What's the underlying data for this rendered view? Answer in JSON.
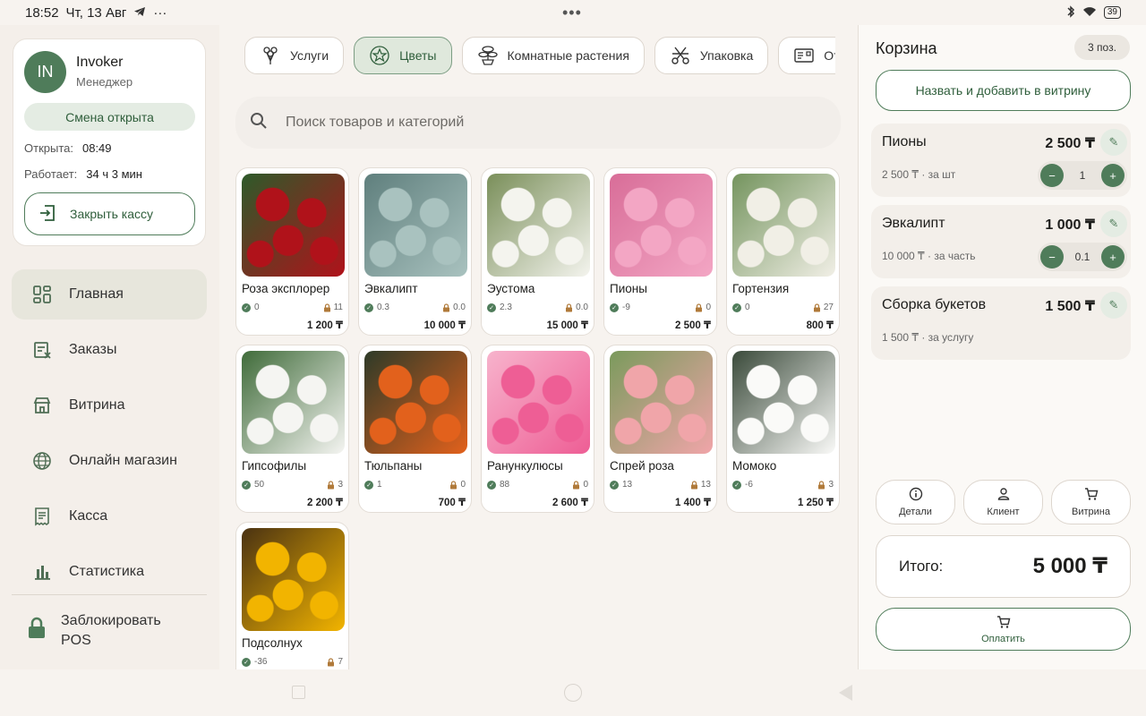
{
  "status_bar": {
    "time": "18:52",
    "date": "Чт, 13 Авг",
    "dots": "•••",
    "battery": "39"
  },
  "user": {
    "initials": "IN",
    "name": "Invoker",
    "role": "Менеджер",
    "shift_status": "Смена открыта",
    "opened_label": "Открыта:",
    "opened_time": "08:49",
    "working_label": "Работает:",
    "working_time": "34 ч 3 мин",
    "close_register": "Закрыть кассу"
  },
  "nav": {
    "items": [
      {
        "label": "Главная",
        "icon": "grid-icon",
        "active": true
      },
      {
        "label": "Заказы",
        "icon": "orders-icon"
      },
      {
        "label": "Витрина",
        "icon": "storefront-icon"
      },
      {
        "label": "Онлайн магазин",
        "icon": "globe-icon"
      },
      {
        "label": "Касса",
        "icon": "receipt-icon"
      },
      {
        "label": "Статистика",
        "icon": "bar-chart-icon"
      }
    ],
    "lock_label_1": "Заблокировать",
    "lock_label_2": "POS"
  },
  "tabs": [
    {
      "label": "Услуги",
      "icon": "bouquet-icon"
    },
    {
      "label": "Цветы",
      "icon": "flower-icon",
      "active": true
    },
    {
      "label": "Комнатные растения",
      "icon": "bonsai-icon"
    },
    {
      "label": "Упаковка",
      "icon": "scissors-icon"
    },
    {
      "label": "Открытки",
      "icon": "postcard-icon"
    }
  ],
  "search": {
    "placeholder": "Поиск товаров и категорий"
  },
  "products": [
    {
      "name": "Роза эксплорер",
      "stock": "0",
      "reserved": "11",
      "price": "1 200 ₸",
      "colors": [
        "#b0121a",
        "#2d5a2a"
      ]
    },
    {
      "name": "Эвкалипт",
      "stock": "0.3",
      "reserved": "0.0",
      "price": "10 000 ₸",
      "colors": [
        "#a9c2bf",
        "#5f7f7d"
      ]
    },
    {
      "name": "Эустома",
      "stock": "2.3",
      "reserved": "0.0",
      "price": "15 000 ₸",
      "colors": [
        "#f4f4ee",
        "#7a8f5a"
      ]
    },
    {
      "name": "Пионы",
      "stock": "-9",
      "reserved": "0",
      "price": "2 500 ₸",
      "colors": [
        "#f3a6c4",
        "#d86d98"
      ]
    },
    {
      "name": "Гортензия",
      "stock": "0",
      "reserved": "27",
      "price": "800 ₸",
      "colors": [
        "#f1efe6",
        "#74945e"
      ]
    },
    {
      "name": "Гипсофилы",
      "stock": "50",
      "reserved": "3",
      "price": "2 200 ₸",
      "colors": [
        "#f5f5f2",
        "#3f6b39"
      ]
    },
    {
      "name": "Тюльпаны",
      "stock": "1",
      "reserved": "0",
      "price": "700 ₸",
      "colors": [
        "#e2611c",
        "#2d3a28"
      ]
    },
    {
      "name": "Ранункулюсы",
      "stock": "88",
      "reserved": "0",
      "price": "2 600 ₸",
      "colors": [
        "#ee5e95",
        "#f7b3cc"
      ]
    },
    {
      "name": "Спрей роза",
      "stock": "13",
      "reserved": "13",
      "price": "1 400 ₸",
      "colors": [
        "#f0a5a9",
        "#7a9a5c"
      ]
    },
    {
      "name": "Момоко",
      "stock": "-6",
      "reserved": "3",
      "price": "1 250 ₸",
      "colors": [
        "#fafaf8",
        "#3a4a3a"
      ]
    },
    {
      "name": "Подсолнух",
      "stock": "-36",
      "reserved": "7",
      "price": "",
      "colors": [
        "#f2b400",
        "#4a3212"
      ]
    }
  ],
  "cart": {
    "title": "Корзина",
    "count": "3 поз.",
    "add_showcase": "Назвать и добавить в витрину",
    "items": [
      {
        "name": "Пионы",
        "price": "2 500 ₸",
        "sub": "2 500 ₸ · за шт",
        "qty": "1",
        "has_stepper": true
      },
      {
        "name": "Эвкалипт",
        "price": "1 000 ₸",
        "sub": "10 000 ₸ · за часть",
        "qty": "0.1",
        "has_stepper": true
      },
      {
        "name": "Сборка букетов",
        "price": "1 500 ₸",
        "sub": "1 500 ₸ · за услугу",
        "qty": "",
        "has_stepper": false
      }
    ],
    "actions": [
      {
        "label": "Детали",
        "icon": "info-icon"
      },
      {
        "label": "Клиент",
        "icon": "person-icon"
      },
      {
        "label": "Витрина",
        "icon": "cart-icon"
      }
    ],
    "total_label": "Итого:",
    "total_value": "5 000 ₸",
    "pay_label": "Оплатить"
  },
  "theme": {
    "accent": "#4f7c5a",
    "accent_light": "#e4ece3",
    "background": "#f7f3ef"
  }
}
